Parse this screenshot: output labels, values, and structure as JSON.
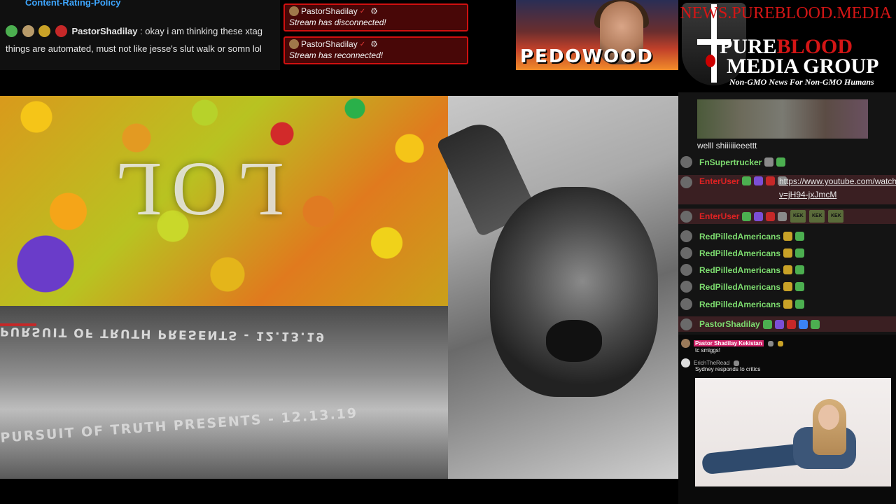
{
  "top_chat": {
    "policy_link": "Content-Rating-Policy",
    "username": "PastorShadilay",
    "message": "okay i am thinking these xtag things are automated, must not like jesse's slut walk or somn lol"
  },
  "alerts": [
    {
      "user": "PastorShadilay",
      "text": "Stream has disconnected!"
    },
    {
      "user": "PastorShadilay",
      "text": "Stream has reconnected!"
    }
  ],
  "thumbnail": {
    "text": "PEDOWOOD"
  },
  "logo": {
    "site": "NEWS.PUREBLOOD.MEDIA",
    "line1_a": "P",
    "line1_b": "URE",
    "line1_c": "BLOOD",
    "line2": "MEDIA GROUP",
    "tagline": "Non-GMO News For Non-GMO Humans"
  },
  "video": {
    "overlay_word": "LOL",
    "band_text_top": "PURSUIT OF TRUTH PRESENTS - 12.13.19",
    "band_text_bottom": "PURSUIT OF TRUTH PRESENTS - 12.13.19"
  },
  "right_chat": {
    "msg_welll": "welll shiiiiiieeettt",
    "user_trucker": "FnSupertrucker",
    "user_enter1": "EnterUser",
    "link_text": "https://www.youtube.com/watch?v=jH94-jxJmcM",
    "user_enter2": "EnterUser",
    "kek": "KEK",
    "user_rpa": "RedPilledAmericans",
    "user_pastor": "PastorShadilay"
  },
  "lower_chat": {
    "name1": "Pastor Shadilay Kekistan",
    "msg1": "tc smiggs!",
    "name2": "ErichTheRead",
    "msg2": "Sydney responds to critics"
  },
  "colors": {
    "accent_link": "#3ea6ff",
    "alert_border": "#d01010",
    "name_green": "#7ddc6f",
    "name_red": "#e02222"
  }
}
